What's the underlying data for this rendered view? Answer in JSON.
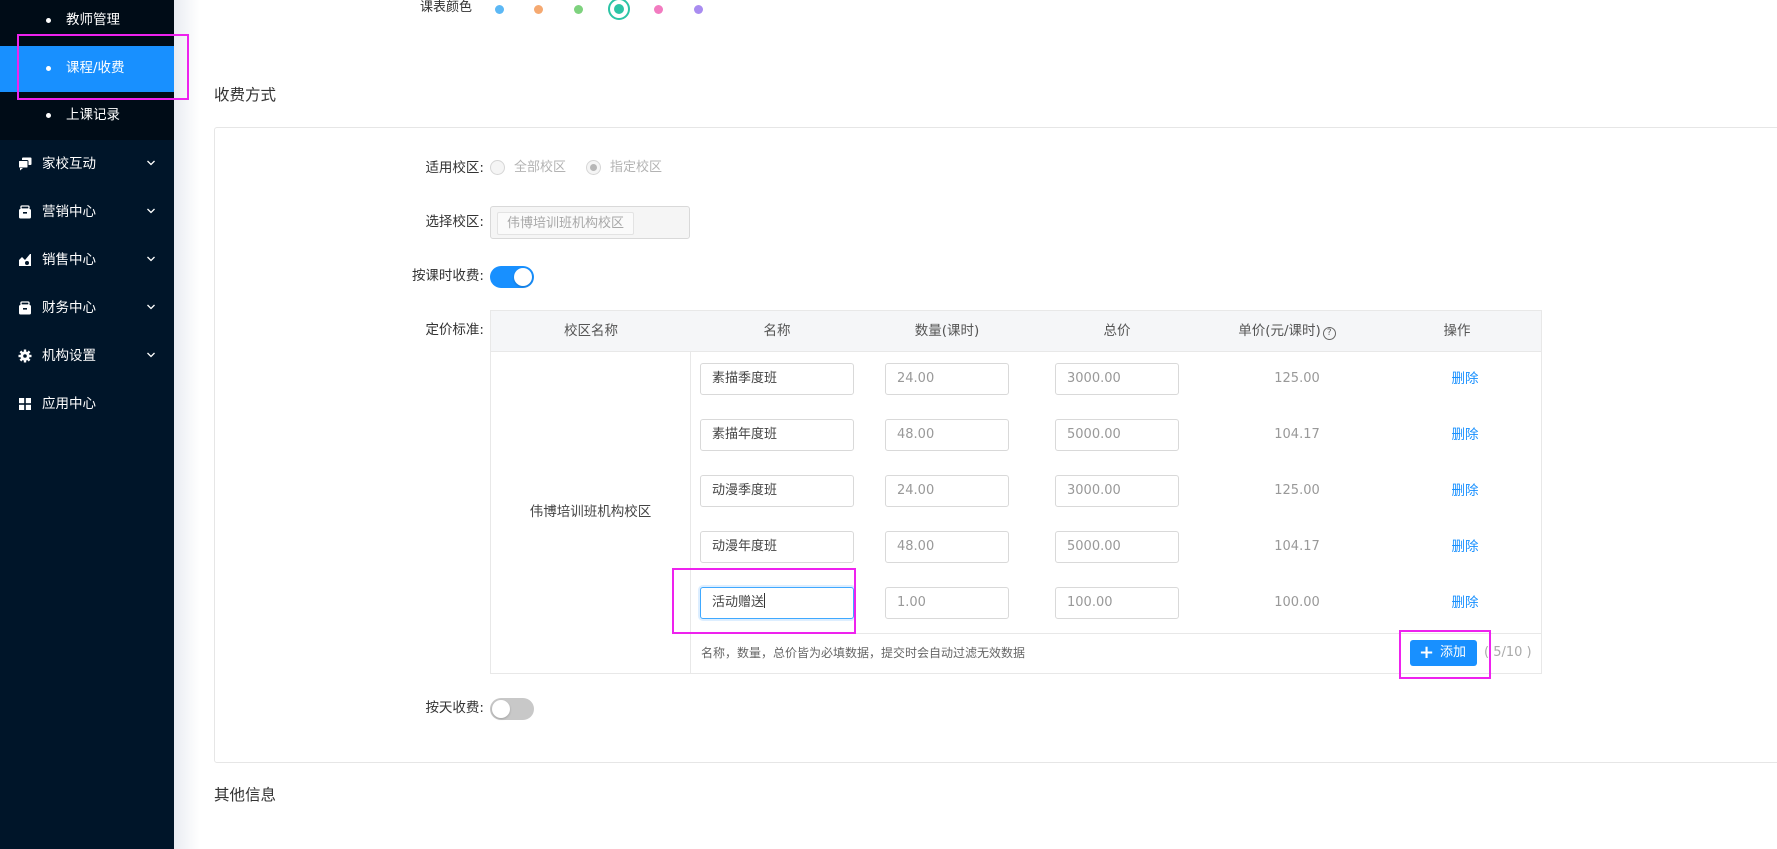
{
  "sidebar": {
    "sub_items": [
      {
        "label": "教师管理"
      },
      {
        "label": "课程/收费"
      },
      {
        "label": "上课记录"
      }
    ],
    "menu_items": [
      {
        "label": "家校互动",
        "icon": "chat-icon"
      },
      {
        "label": "营销中心",
        "icon": "gift-icon"
      },
      {
        "label": "销售中心",
        "icon": "chart-icon"
      },
      {
        "label": "财务中心",
        "icon": "wallet-icon"
      },
      {
        "label": "机构设置",
        "icon": "gear-icon"
      },
      {
        "label": "应用中心",
        "icon": "grid-icon"
      }
    ]
  },
  "schedule_color": {
    "label": "课表颜色",
    "colors": [
      "#5cb8f5",
      "#f5a971",
      "#7ed27e",
      "#2cc4a5",
      "#f27bc0",
      "#a98cf0"
    ],
    "selected_index": 3
  },
  "sections": {
    "fee_title": "收费方式",
    "other_title": "其他信息"
  },
  "form": {
    "campus_scope_label": "适用校区:",
    "scope_all": "全部校区",
    "scope_specific": "指定校区",
    "scope_selected": "指定校区",
    "select_campus_label": "选择校区:",
    "selected_campus_tag": "伟博培训班机构校区",
    "hourly_label": "按课时收费:",
    "hourly_enabled": true,
    "pricing_label": "定价标准:",
    "daily_label": "按天收费:",
    "daily_enabled": false
  },
  "pricing_table": {
    "headers": {
      "campus": "校区名称",
      "name": "名称",
      "qty": "数量(课时)",
      "total": "总价",
      "unit": "单价(元/课时)",
      "action": "操作"
    },
    "campus_name": "伟博培训班机构校区",
    "delete_label": "删除",
    "rows": [
      {
        "name": "素描季度班",
        "qty": "24.00",
        "total": "3000.00",
        "unit": "125.00"
      },
      {
        "name": "素描年度班",
        "qty": "48.00",
        "total": "5000.00",
        "unit": "104.17"
      },
      {
        "name": "动漫季度班",
        "qty": "24.00",
        "total": "3000.00",
        "unit": "125.00"
      },
      {
        "name": "动漫年度班",
        "qty": "48.00",
        "total": "5000.00",
        "unit": "104.17"
      },
      {
        "name": "活动赠送",
        "qty": "1.00",
        "total": "100.00",
        "unit": "100.00"
      }
    ],
    "hint": "名称，数量，总价皆为必填数据，提交时会自动过滤无效数据",
    "add_label": "添加",
    "counter": "( 5/10 )"
  },
  "colors": {
    "sidebar_bg": "#001529",
    "accent": "#1890ff",
    "annotation": "#ee22ee"
  }
}
